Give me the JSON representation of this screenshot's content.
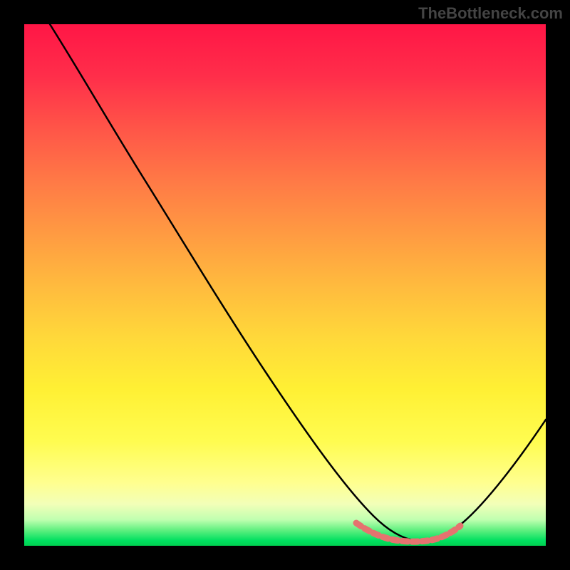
{
  "watermark": "TheBottleneck.com",
  "chart_data": {
    "type": "line",
    "title": "",
    "xlabel": "",
    "ylabel": "",
    "xlim": [
      0,
      100
    ],
    "ylim": [
      0,
      100
    ],
    "note": "Bottleneck-style rainbow gradient chart with a V-shaped black curve whose minimum lies around x≈75. Pink highlight marks the near-zero band at the trough. No axis ticks or labels are rendered.",
    "series": [
      {
        "name": "bottleneck-curve",
        "color": "#000000",
        "x": [
          5,
          15,
          25,
          35,
          45,
          55,
          62,
          68,
          72,
          76,
          80,
          84,
          88,
          92,
          96,
          100
        ],
        "values": [
          100,
          86,
          72,
          57,
          42,
          27,
          17,
          9,
          4,
          1,
          1,
          4,
          9,
          16,
          25,
          35
        ]
      },
      {
        "name": "optimal-zone-marker",
        "color": "#e5736f",
        "x": [
          64,
          68,
          72,
          76,
          80,
          84
        ],
        "values": [
          4.5,
          3.0,
          2.3,
          2.2,
          2.8,
          4.2
        ]
      }
    ],
    "gradient_stops": [
      {
        "pos": 0,
        "color": "#ff1646"
      },
      {
        "pos": 50,
        "color": "#ffba3e"
      },
      {
        "pos": 88,
        "color": "#ffff90"
      },
      {
        "pos": 100,
        "color": "#00d050"
      }
    ]
  }
}
